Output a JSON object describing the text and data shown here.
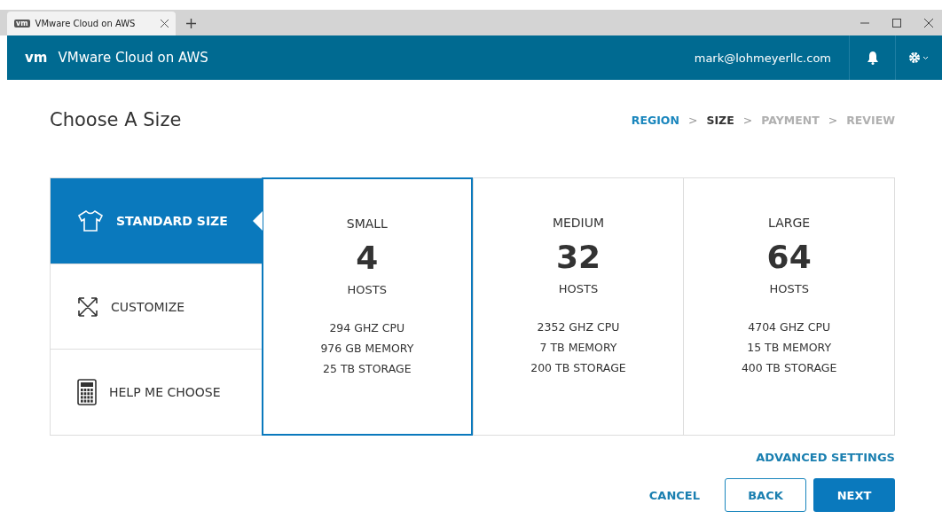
{
  "browser": {
    "tab_title": "VMware Cloud on AWS",
    "logo": "vm"
  },
  "header": {
    "logo": "vm",
    "title": "VMware Cloud on AWS",
    "user": "mark@lohmeyerllc.com"
  },
  "page": {
    "title": "Choose A Size"
  },
  "steps": [
    {
      "label": "REGION",
      "completed": true,
      "selected": false
    },
    {
      "label": "SIZE",
      "completed": false,
      "selected": true
    },
    {
      "label": "PAYMENT",
      "completed": false,
      "selected": false
    },
    {
      "label": "REVIEW",
      "completed": false,
      "selected": false
    }
  ],
  "step_separator": ">",
  "options": [
    {
      "label": "STANDARD SIZE",
      "kind": "shirt",
      "selected": true
    },
    {
      "label": "CUSTOMIZE",
      "kind": "expand",
      "selected": false
    },
    {
      "label": "HELP ME CHOOSE",
      "kind": "calculator",
      "selected": false
    }
  ],
  "sizes": [
    {
      "name": "SMALL",
      "hosts": "4",
      "unit": "HOSTS",
      "specs": [
        "294 GHZ CPU",
        "976 GB MEMORY",
        "25 TB STORAGE"
      ],
      "selected": true
    },
    {
      "name": "MEDIUM",
      "hosts": "32",
      "unit": "HOSTS",
      "specs": [
        "2352 GHZ CPU",
        "7 TB MEMORY",
        "200 TB STORAGE"
      ],
      "selected": false
    },
    {
      "name": "LARGE",
      "hosts": "64",
      "unit": "HOSTS",
      "specs": [
        "4704 GHZ CPU",
        "15 TB MEMORY",
        "400 TB STORAGE"
      ],
      "selected": false
    }
  ],
  "advanced_link": "ADVANCED SETTINGS",
  "buttons": {
    "cancel": "CANCEL",
    "back": "BACK",
    "next": "NEXT"
  }
}
